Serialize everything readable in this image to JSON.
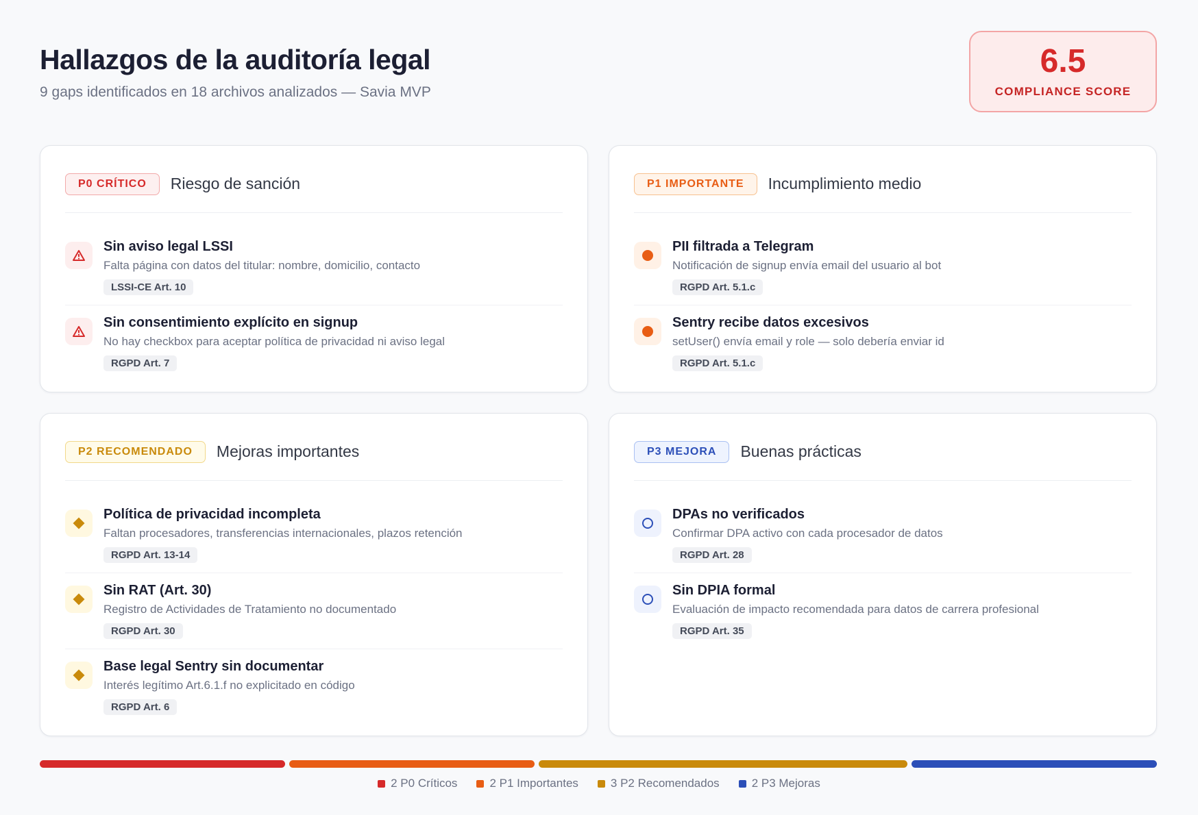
{
  "header": {
    "title": "Hallazgos de la auditoría legal",
    "subtitle": "9 gaps identificados en 18 archivos analizados — Savia MVP"
  },
  "score": {
    "value": "6.5",
    "label": "COMPLIANCE SCORE"
  },
  "colors": {
    "p0": "#d62a2a",
    "p1": "#e85d14",
    "p2": "#c98a0b",
    "p3": "#2c4fb8"
  },
  "cards": [
    {
      "badge": "P0 CRÍTICO",
      "title": "Riesgo de sanción",
      "icon": "warning-triangle-icon",
      "items": [
        {
          "title": "Sin aviso legal LSSI",
          "desc": "Falta página con datos del titular: nombre, domicilio, contacto",
          "ref": "LSSI-CE Art. 10"
        },
        {
          "title": "Sin consentimiento explícito en signup",
          "desc": "No hay checkbox para aceptar política de privacidad ni aviso legal",
          "ref": "RGPD Art. 7"
        }
      ]
    },
    {
      "badge": "P1 IMPORTANTE",
      "title": "Incumplimiento medio",
      "icon": "filled-circle-icon",
      "items": [
        {
          "title": "PII filtrada a Telegram",
          "desc": "Notificación de signup envía email del usuario al bot",
          "ref": "RGPD Art. 5.1.c"
        },
        {
          "title": "Sentry recibe datos excesivos",
          "desc": "setUser() envía email y role — solo debería enviar id",
          "ref": "RGPD Art. 5.1.c"
        }
      ]
    },
    {
      "badge": "P2 RECOMENDADO",
      "title": "Mejoras importantes",
      "icon": "diamond-icon",
      "items": [
        {
          "title": "Política de privacidad incompleta",
          "desc": "Faltan procesadores, transferencias internacionales, plazos retención",
          "ref": "RGPD Art. 13-14"
        },
        {
          "title": "Sin RAT (Art. 30)",
          "desc": "Registro de Actividades de Tratamiento no documentado",
          "ref": "RGPD Art. 30"
        },
        {
          "title": "Base legal Sentry sin documentar",
          "desc": "Interés legítimo Art.6.1.f no explicitado en código",
          "ref": "RGPD Art. 6"
        }
      ]
    },
    {
      "badge": "P3 MEJORA",
      "title": "Buenas prácticas",
      "icon": "hollow-circle-icon",
      "items": [
        {
          "title": "DPAs no verificados",
          "desc": "Confirmar DPA activo con cada procesador de datos",
          "ref": "RGPD Art. 28"
        },
        {
          "title": "Sin DPIA formal",
          "desc": "Evaluación de impacto recomendada para datos de carrera profesional",
          "ref": "RGPD Art. 35"
        }
      ]
    }
  ],
  "legend": [
    {
      "label": "2 P0 Críticos",
      "count": 2
    },
    {
      "label": "2 P1 Importantes",
      "count": 2
    },
    {
      "label": "3 P2 Recomendados",
      "count": 3
    },
    {
      "label": "2 P3 Mejoras",
      "count": 2
    }
  ]
}
